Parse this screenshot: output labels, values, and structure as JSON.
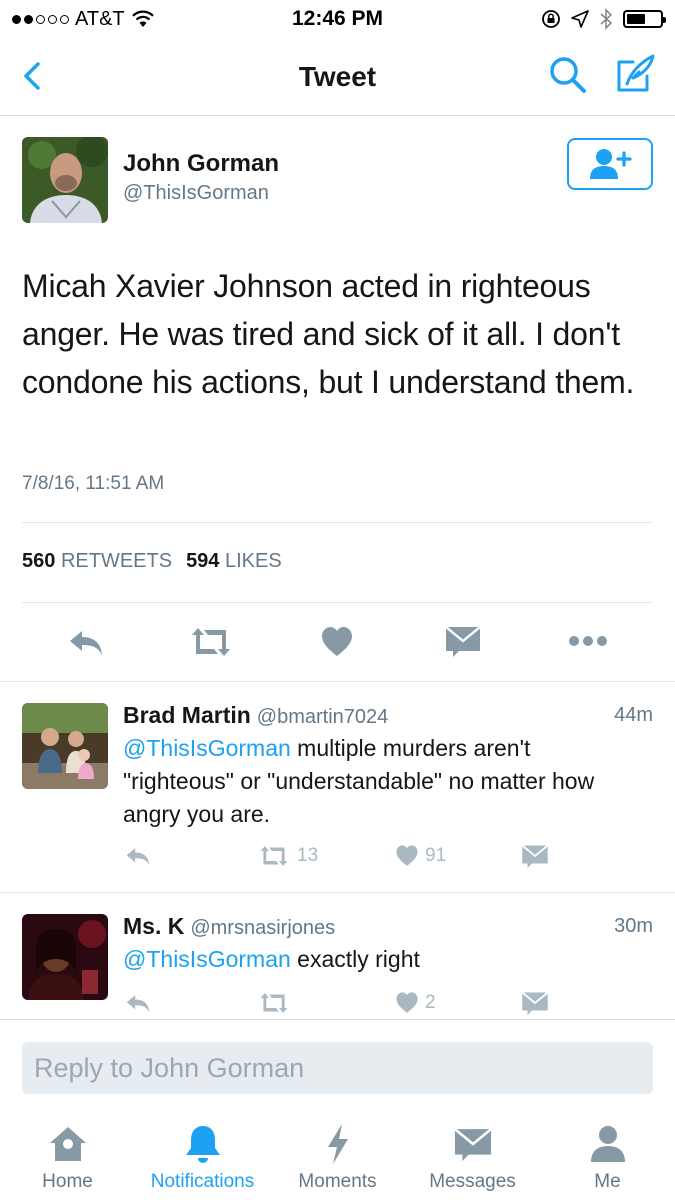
{
  "status_bar": {
    "carrier": "AT&T",
    "time": "12:46 PM",
    "signal_bars_filled": 2,
    "signal_bars_total": 5,
    "battery_level": 0.55
  },
  "nav": {
    "title": "Tweet",
    "back_icon": "chevron-left-icon",
    "search_icon": "search-icon",
    "compose_icon": "compose-icon"
  },
  "tweet": {
    "author_name": "John Gorman",
    "author_handle": "@ThisIsGorman",
    "text": "Micah Xavier Johnson acted in righteous anger. He was tired and sick of it all. I don't condone his actions, but I understand them.",
    "timestamp": "7/8/16, 11:51 AM",
    "retweets_count": "560",
    "retweets_label": "RETWEETS",
    "likes_count": "594",
    "likes_label": "LIKES"
  },
  "replies": [
    {
      "name": "Brad Martin",
      "handle": "@bmartin7024",
      "time": "44m",
      "mention": "@ThisIsGorman",
      "text": " multiple murders aren't \"righteous\" or \"understandable\" no matter how angry you are.",
      "retweets": "13",
      "likes": "91"
    },
    {
      "name": "Ms. K",
      "handle": "@mrsnasirjones",
      "time": "30m",
      "mention": "@ThisIsGorman",
      "text": " exactly right",
      "retweets": "",
      "likes": "2"
    }
  ],
  "reply_bar": {
    "placeholder": "Reply to John Gorman"
  },
  "tabs": [
    {
      "label": "Home",
      "icon": "home-icon"
    },
    {
      "label": "Notifications",
      "icon": "bell-icon",
      "active": true
    },
    {
      "label": "Moments",
      "icon": "lightning-icon"
    },
    {
      "label": "Messages",
      "icon": "envelope-icon"
    },
    {
      "label": "Me",
      "icon": "person-icon"
    }
  ],
  "colors": {
    "accent": "#1da1f2",
    "text_secondary": "#657786",
    "icon_gray": "#8899a6",
    "icon_light": "#aab8c2"
  }
}
